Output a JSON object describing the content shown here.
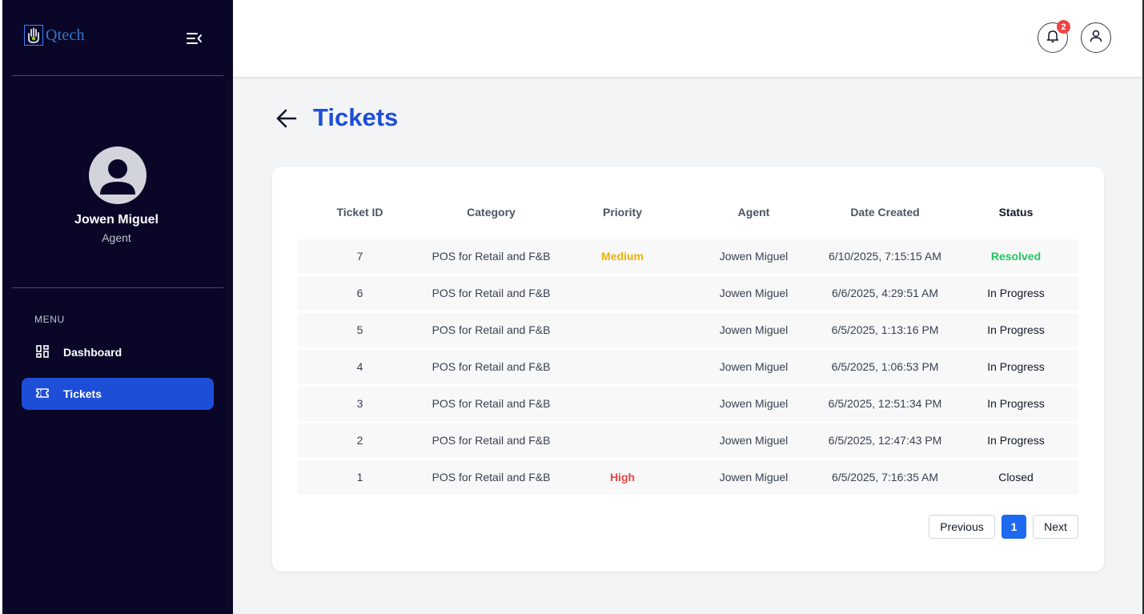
{
  "brand": {
    "name": "Qtech",
    "logo_icon": "hand-logo-icon"
  },
  "sidebar": {
    "profile": {
      "name": "Jowen Miguel",
      "role": "Agent"
    },
    "menu_heading": "MENU",
    "items": [
      {
        "label": "Dashboard",
        "icon": "grid-icon",
        "active": false
      },
      {
        "label": "Tickets",
        "icon": "ticket-icon",
        "active": true
      }
    ]
  },
  "header": {
    "notification_count": "2"
  },
  "page": {
    "title": "Tickets"
  },
  "table": {
    "columns": [
      "Ticket ID",
      "Category",
      "Priority",
      "Agent",
      "Date Created",
      "Status"
    ],
    "rows": [
      {
        "id": "7",
        "category": "POS for Retail and F&B",
        "priority": "Medium",
        "agent": "Jowen Miguel",
        "date": "6/10/2025, 7:15:15 AM",
        "status": "Resolved"
      },
      {
        "id": "6",
        "category": "POS for Retail and F&B",
        "priority": "",
        "agent": "Jowen Miguel",
        "date": "6/6/2025, 4:29:51 AM",
        "status": "In Progress"
      },
      {
        "id": "5",
        "category": "POS for Retail and F&B",
        "priority": "",
        "agent": "Jowen Miguel",
        "date": "6/5/2025, 1:13:16 PM",
        "status": "In Progress"
      },
      {
        "id": "4",
        "category": "POS for Retail and F&B",
        "priority": "",
        "agent": "Jowen Miguel",
        "date": "6/5/2025, 1:06:53 PM",
        "status": "In Progress"
      },
      {
        "id": "3",
        "category": "POS for Retail and F&B",
        "priority": "",
        "agent": "Jowen Miguel",
        "date": "6/5/2025, 12:51:34 PM",
        "status": "In Progress"
      },
      {
        "id": "2",
        "category": "POS for Retail and F&B",
        "priority": "",
        "agent": "Jowen Miguel",
        "date": "6/5/2025, 12:47:43 PM",
        "status": "In Progress"
      },
      {
        "id": "1",
        "category": "POS for Retail and F&B",
        "priority": "High",
        "agent": "Jowen Miguel",
        "date": "6/5/2025, 7:16:35 AM",
        "status": "Closed"
      }
    ]
  },
  "pagination": {
    "previous_label": "Previous",
    "current_page": "1",
    "next_label": "Next"
  },
  "colors": {
    "sidebar_bg": "#0a0628",
    "accent": "#1d4ed8",
    "priority_medium": "#eab308",
    "priority_high": "#ef4444",
    "status_resolved": "#22c55e",
    "badge": "#ef4444"
  }
}
